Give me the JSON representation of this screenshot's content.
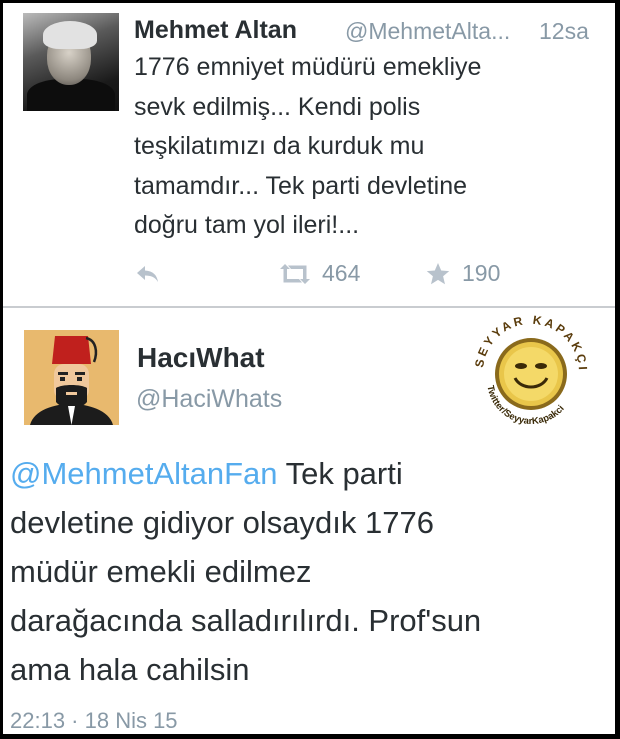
{
  "tweet1": {
    "name": "Mehmet Altan",
    "handle": "@MehmetAlta...",
    "time": "12sa",
    "lines": [
      "1776 emniyet müdürü emekliye",
      "sevk edilmiş... Kendi polis",
      "teşkilatımızı da kurduk mu",
      "tamamdır... Tek parti devletine",
      "doğru tam yol ileri!..."
    ],
    "retweet_count": "464",
    "favorite_count": "190",
    "icons": {
      "reply": "reply-icon",
      "retweet": "retweet-icon",
      "favorite": "star-icon"
    }
  },
  "tweet2": {
    "name": "HacıWhat",
    "handle": "@HaciWhats",
    "mention": "@MehmetAltanFan",
    "first_line_rest": " Tek parti",
    "lines": [
      "devletine gidiyor olsaydık 1776",
      "müdür emekli edilmez",
      "darağacında salladırılırdı. Prof'sun",
      "ama hala cahilsin"
    ],
    "timestamp": "22:13 · 18 Nis 15"
  },
  "watermark": {
    "top_text": "SEYYAR KAPAKÇI",
    "bottom_text": "Twitter/SeyyarKapakci"
  },
  "colors": {
    "text": "#292f33",
    "muted": "#8899a6",
    "link": "#55acee",
    "frame": "#000000"
  }
}
